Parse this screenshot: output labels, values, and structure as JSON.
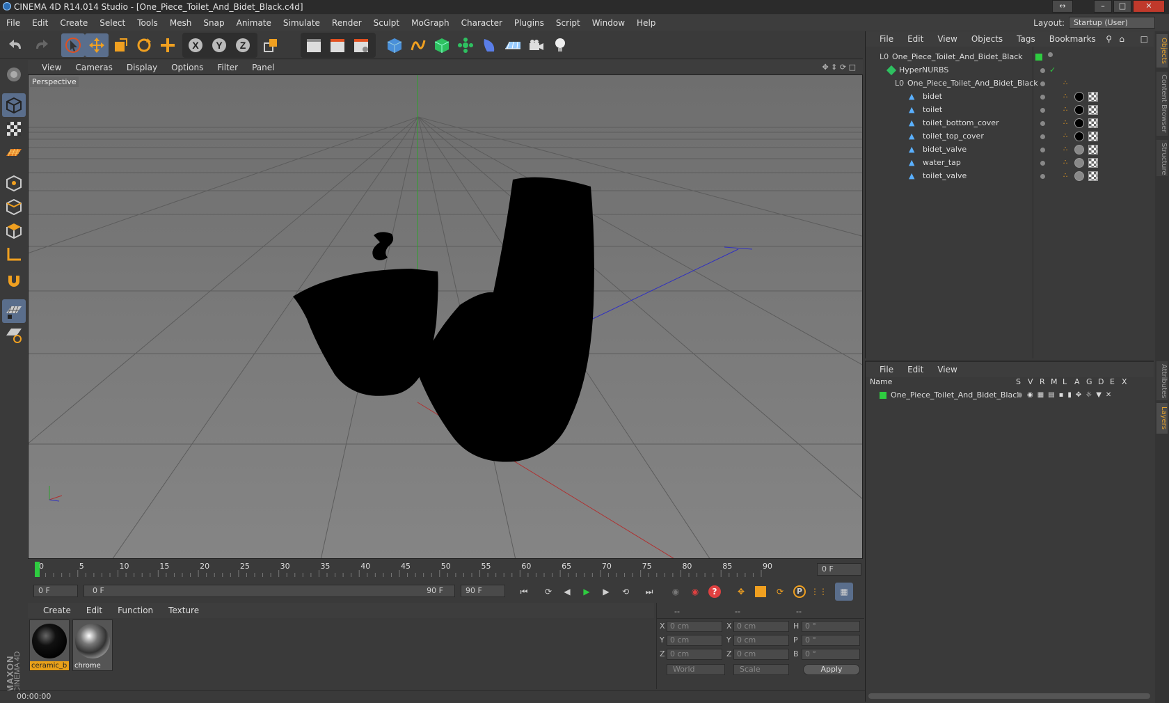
{
  "window": {
    "title": "CINEMA 4D R14.014 Studio - [One_Piece_Toilet_And_Bidet_Black.c4d]"
  },
  "menubar": {
    "items": [
      "File",
      "Edit",
      "Create",
      "Select",
      "Tools",
      "Mesh",
      "Snap",
      "Animate",
      "Simulate",
      "Render",
      "Sculpt",
      "MoGraph",
      "Character",
      "Plugins",
      "Script",
      "Window",
      "Help"
    ],
    "layout_label": "Layout:",
    "layout_value": "Startup (User)"
  },
  "viewport": {
    "menu": [
      "View",
      "Cameras",
      "Display",
      "Options",
      "Filter",
      "Panel"
    ],
    "label": "Perspective"
  },
  "timeline": {
    "ticks": [
      "0",
      "5",
      "10",
      "15",
      "20",
      "25",
      "30",
      "35",
      "40",
      "45",
      "50",
      "55",
      "60",
      "65",
      "70",
      "75",
      "80",
      "85",
      "90"
    ],
    "current_frame": "0 F",
    "start_field": "0 F",
    "range_start": "0 F",
    "range_end": "90 F",
    "end_field": "90 F"
  },
  "material_panel": {
    "menu": [
      "Create",
      "Edit",
      "Function",
      "Texture"
    ],
    "materials": [
      {
        "name": "ceramic_b",
        "selected": true
      },
      {
        "name": "chrome",
        "selected": false
      }
    ]
  },
  "coord_panel": {
    "headers": [
      "--",
      "--",
      "--"
    ],
    "rows": [
      {
        "a": "X",
        "av": "0 cm",
        "b": "X",
        "bv": "0 cm",
        "c": "H",
        "cv": "0 °"
      },
      {
        "a": "Y",
        "av": "0 cm",
        "b": "Y",
        "bv": "0 cm",
        "c": "P",
        "cv": "0 °"
      },
      {
        "a": "Z",
        "av": "0 cm",
        "b": "Z",
        "bv": "0 cm",
        "c": "B",
        "cv": "0 °"
      }
    ],
    "world_dd": "World",
    "scale_dd": "Scale",
    "apply": "Apply"
  },
  "object_manager": {
    "menu": [
      "File",
      "Edit",
      "View",
      "Objects",
      "Tags",
      "Bookmarks"
    ],
    "objects": [
      {
        "name": "One_Piece_Toilet_And_Bidet_Black",
        "level": 0
      },
      {
        "name": "HyperNURBS",
        "level": 1
      },
      {
        "name": "One_Piece_Toilet_And_Bidet_Black",
        "level": 2
      },
      {
        "name": "bidet",
        "level": 3
      },
      {
        "name": "toilet",
        "level": 3
      },
      {
        "name": "toilet_bottom_cover",
        "level": 3
      },
      {
        "name": "toilet_top_cover",
        "level": 3
      },
      {
        "name": "bidet_valve",
        "level": 3
      },
      {
        "name": "water_tap",
        "level": 3
      },
      {
        "name": "toilet_valve",
        "level": 3
      }
    ]
  },
  "layer_manager": {
    "menu": [
      "File",
      "Edit",
      "View"
    ],
    "columns": [
      "Name",
      "S",
      "V",
      "R",
      "M",
      "L",
      "A",
      "G",
      "D",
      "E",
      "X"
    ],
    "layer_name": "One_Piece_Toilet_And_Bidet_Black"
  },
  "side_tabs": [
    "Objects",
    "Content Browser",
    "Structure",
    "Attributes",
    "Layers"
  ],
  "status": {
    "time": "00:00:00"
  },
  "brand": {
    "line1": "MAXON",
    "line2": "CINEMA 4D"
  },
  "colors": {
    "accent": "#e8a019",
    "selection": "#5a6e8c",
    "green": "#2ecc40"
  }
}
